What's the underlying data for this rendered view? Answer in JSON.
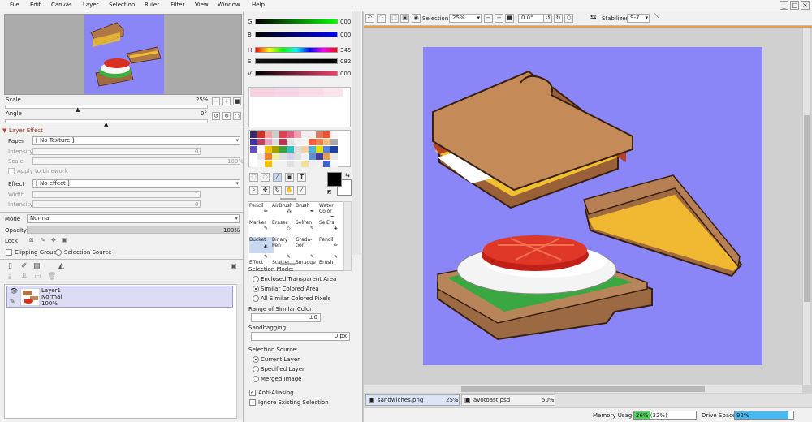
{
  "menu": {
    "items": [
      "File",
      "Edit",
      "Canvas",
      "Layer",
      "Selection",
      "Ruler",
      "Filter",
      "View",
      "Window",
      "Help"
    ]
  },
  "navigator": {
    "scale_label": "Scale",
    "scale_value": "25%",
    "angle_label": "Angle",
    "angle_value": "0°"
  },
  "layer_effect": {
    "title": "Layer Effect",
    "paper_label": "Paper",
    "paper_value": "[ No Texture ]",
    "intensity_label": "Intensity",
    "intensity_value": "0",
    "scale_label": "Scale",
    "scale_value": "100%",
    "apply_label": "Apply to Linework",
    "effect_label": "Effect",
    "effect_value": "[ No effect ]",
    "width_label": "Width",
    "width_value": "1",
    "intensity2_label": "Intensity",
    "intensity2_value": "0"
  },
  "layer_props": {
    "mode_label": "Mode",
    "mode_value": "Normal",
    "opacity_label": "Opacity",
    "opacity_value": "100%",
    "lock_label": "Lock",
    "clipping_label": "Clipping Group",
    "selection_source_label": "Selection Source"
  },
  "layer_list": [
    {
      "name": "Layer1",
      "mode": "Normal",
      "opacity": "100%"
    }
  ],
  "color": {
    "g_label": "G",
    "g_value": "000",
    "b_label": "B",
    "b_value": "000",
    "h_label": "H",
    "h_value": "345",
    "s_label": "S",
    "s_value": "082",
    "v_label": "V",
    "v_value": "000",
    "primary": "#000000",
    "secondary": "#ffffff"
  },
  "tools": [
    {
      "label": "Pencil"
    },
    {
      "label": "AirBrush"
    },
    {
      "label": "Brush"
    },
    {
      "label": "Water Color"
    },
    {
      "label": "Marker"
    },
    {
      "label": "Eraser"
    },
    {
      "label": "SelPen"
    },
    {
      "label": "SelErs"
    },
    {
      "label": "Bucket"
    },
    {
      "label": "Binary Pen"
    },
    {
      "label": "Grada- tion"
    },
    {
      "label": "Pencil"
    },
    {
      "label": "Effect"
    },
    {
      "label": "Scatter"
    },
    {
      "label": "Smudge"
    },
    {
      "label": "Brush"
    }
  ],
  "bucket_options": {
    "selection_mode_label": "Selection Mode:",
    "mode_options": [
      "Enclosed Transparent Area",
      "Similar Colored Area",
      "All Similar Colored Pixels"
    ],
    "mode_selected": 1,
    "range_label": "Range of Similar Color:",
    "range_value": "±0",
    "sandbagging_label": "Sandbagging:",
    "sandbagging_value": "0 px",
    "source_label": "Selection Source:",
    "source_options": [
      "Current Layer",
      "Specified Layer",
      "Merged Image"
    ],
    "source_selected": 0,
    "anti_alias_label": "Anti-Aliasing",
    "ignore_label": "Ignore Existing Selection"
  },
  "toolbar": {
    "selection_label": "Selection",
    "zoom_value": "25%",
    "angle_value": "0.0°",
    "stabilizer_label": "Stabilizer",
    "stabilizer_value": "S-7"
  },
  "tabs": [
    {
      "name": "sandwiches.png",
      "zoom": "25%"
    },
    {
      "name": "avotoast.psd",
      "zoom": "50%"
    }
  ],
  "status": {
    "memory_label": "Memory Usage",
    "memory_value": "26% (32%)",
    "memory_fraction": 0.26,
    "drive_label": "Drive Space",
    "drive_value": "92%",
    "drive_fraction": 0.92
  },
  "colors": {
    "canvas_bg": "#8a86f8",
    "accent": "#c04020"
  }
}
